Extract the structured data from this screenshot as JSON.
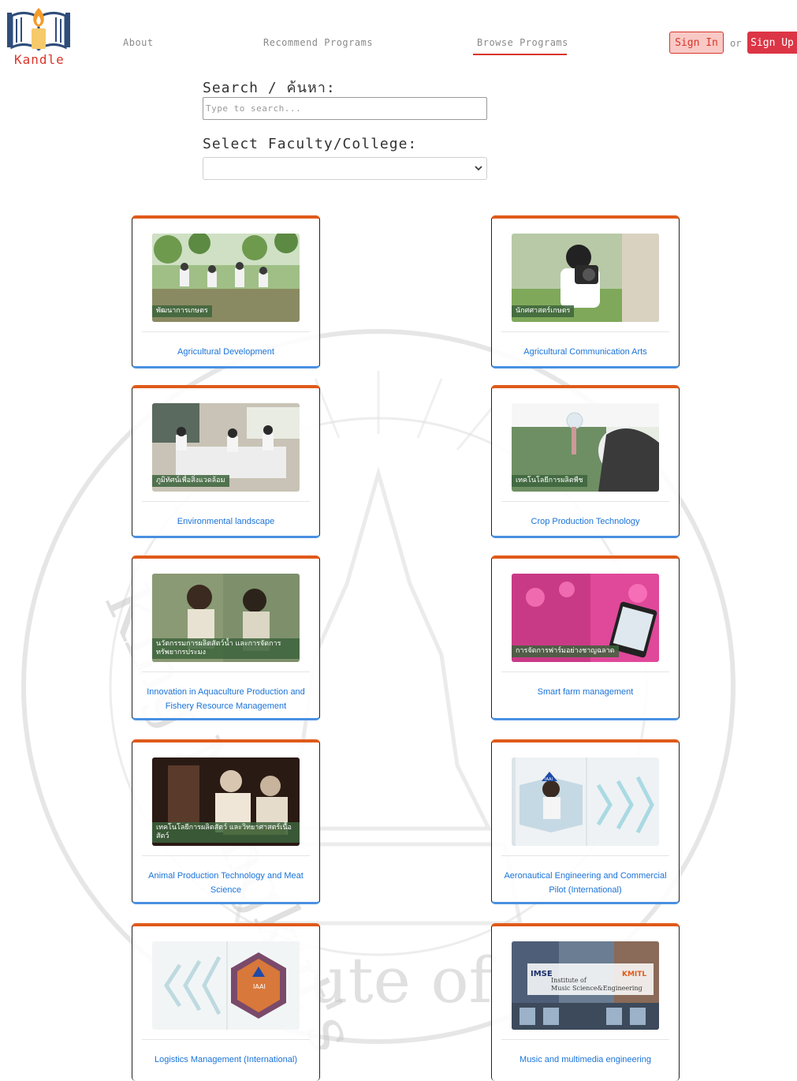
{
  "header": {
    "logo_text": "Kandle",
    "nav": [
      {
        "label": "About"
      },
      {
        "label": "Recommend Programs"
      },
      {
        "label": "Browse Programs",
        "active": true
      }
    ],
    "sign_in": "Sign In",
    "or": "or",
    "sign_up": "Sign Up"
  },
  "search": {
    "label": "Search / ค้นหา:",
    "placeholder": "Type to search...",
    "value": ""
  },
  "faculty": {
    "label": "Select Faculty/College:",
    "selected": ""
  },
  "programs": [
    {
      "title": "Agricultural Development",
      "image_caption": "พัฒนาการเกษตร",
      "image_kind": "field-people-photo"
    },
    {
      "title": "Agricultural Communication Arts",
      "image_caption": "นักศศาสตร์เกษตร",
      "image_kind": "photographer-photo"
    },
    {
      "title": "Environmental landscape",
      "image_caption": "ภูมิทัศน์เพื่อสิ่งแวดล้อม",
      "image_kind": "classroom-photo"
    },
    {
      "title": "Crop Production Technology",
      "image_caption": "เทคโนโลยีการผลิตพืช",
      "image_kind": "lab-photo"
    },
    {
      "title": "Innovation in Aquaculture Production and Fishery Resource Management",
      "image_caption": "นวัตกรรมการผลิตสัตว์น้ำ และการจัดการทรัพยากรประมง",
      "image_kind": "aquaculture-photo"
    },
    {
      "title": "Smart farm management",
      "image_caption": "การจัดการฟาร์มอย่างชาญฉลาด",
      "image_kind": "smart-farm-photo"
    },
    {
      "title": "Animal Production Technology and Meat Science",
      "image_caption": "เทคโนโลยีการผลิตสัตว์ และวิทยาศาสตร์เนื้อสัตว์",
      "image_kind": "meat-lab-photo"
    },
    {
      "title": "Aeronautical Engineering and Commercial Pilot (International)",
      "image_caption": "",
      "image_kind": "iaai-pilot-banner"
    },
    {
      "title": "Logistics Management (International)",
      "image_caption": "",
      "image_kind": "iaai-logistics-banner"
    },
    {
      "title": "Music and multimedia engineering",
      "image_caption": "",
      "image_kind": "imse-banner"
    }
  ],
  "imse_banner": {
    "brand": "IMSE",
    "brand2": "KMITL",
    "line1": "Institute of",
    "line2": "Music Science&Engineering"
  },
  "iaai_badge": "IAAI",
  "watermark": {
    "text": "King Mongkut's Institute of Technology Ladkrabang",
    "visible_fragment": "ute of Te"
  },
  "colors": {
    "accent_red": "#d9352b",
    "card_top": "#e05a1a",
    "card_bottom": "#4a90e2",
    "link_blue": "#1a73d9"
  }
}
